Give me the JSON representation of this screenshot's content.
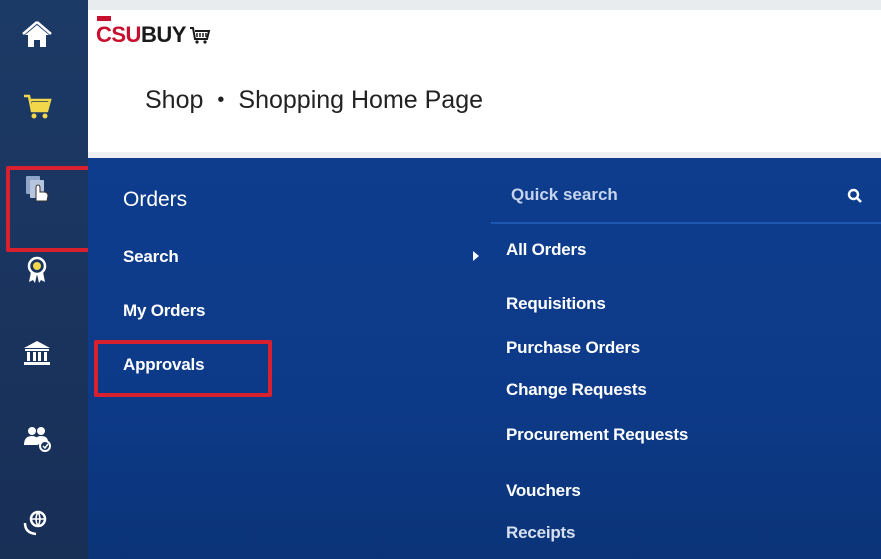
{
  "app": {
    "logo_primary": "CSU",
    "logo_secondary": "BUY",
    "brand_color": "#c8102e"
  },
  "header": {
    "breadcrumb": [
      {
        "label": "Shop"
      },
      {
        "label": "Shopping Home Page"
      }
    ],
    "separator": "•"
  },
  "rail": {
    "items": [
      {
        "icon": "home-icon"
      },
      {
        "icon": "shopping-cart-icon"
      },
      {
        "icon": "orders-document-icon",
        "active": true
      },
      {
        "icon": "award-ribbon-icon"
      },
      {
        "icon": "bank-building-icon"
      },
      {
        "icon": "users-group-icon"
      },
      {
        "icon": "globe-hands-icon"
      }
    ]
  },
  "flyout": {
    "section_title": "Orders",
    "left_items": [
      "Search",
      "My Orders",
      "Approvals"
    ],
    "quick_search": {
      "placeholder": "Quick search",
      "icon": "search-icon"
    },
    "right_items": [
      "All Orders",
      "Requisitions",
      "Purchase Orders",
      "Change Requests",
      "Procurement Requests",
      "Vouchers",
      "Receipts"
    ]
  },
  "colors": {
    "rail_bg": "#1a3560",
    "flyout_bg": "#0d3a88",
    "highlight": "#d8202f"
  }
}
